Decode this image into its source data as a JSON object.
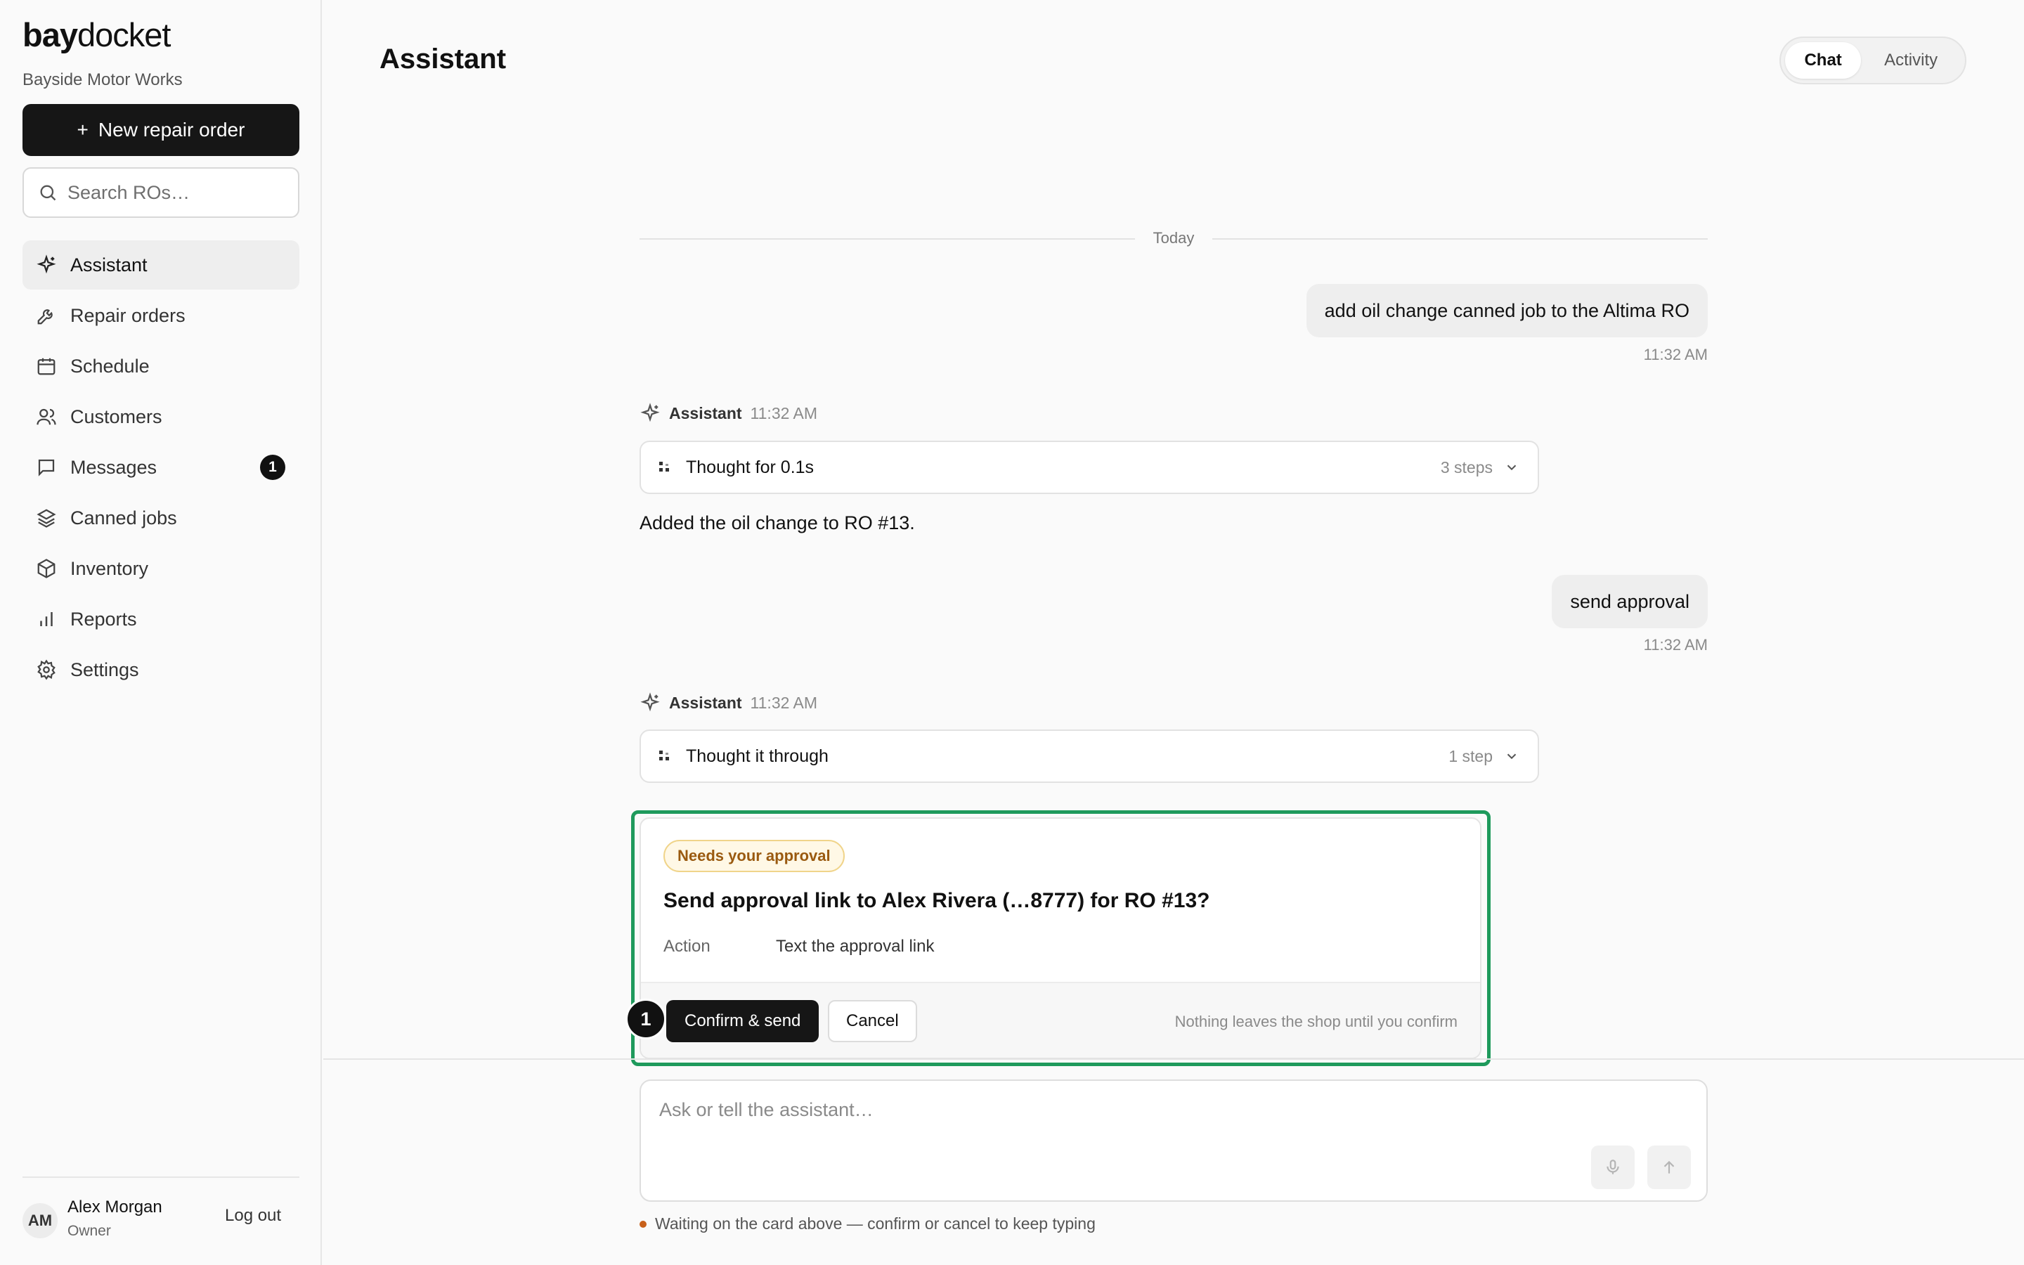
{
  "brand": {
    "logo_bold": "bay",
    "logo_light": "docket",
    "shop_name": "Bayside Motor Works"
  },
  "sidebar": {
    "new_ro_label": "New repair order",
    "search_placeholder": "Search ROs…",
    "items": [
      {
        "label": "Assistant",
        "icon": "sparkle-icon",
        "active": true
      },
      {
        "label": "Repair orders",
        "icon": "wrench-icon"
      },
      {
        "label": "Schedule",
        "icon": "calendar-icon"
      },
      {
        "label": "Customers",
        "icon": "users-icon"
      },
      {
        "label": "Messages",
        "icon": "message-icon",
        "badge": "1"
      },
      {
        "label": "Canned jobs",
        "icon": "layers-icon"
      },
      {
        "label": "Inventory",
        "icon": "box-icon"
      },
      {
        "label": "Reports",
        "icon": "bar-chart-icon"
      },
      {
        "label": "Settings",
        "icon": "gear-icon"
      }
    ],
    "user": {
      "initials": "AM",
      "name": "Alex Morgan",
      "role": "Owner",
      "logout_label": "Log out"
    }
  },
  "header": {
    "title": "Assistant",
    "tabs": [
      {
        "label": "Chat",
        "active": true
      },
      {
        "label": "Activity",
        "active": false
      }
    ]
  },
  "chat": {
    "day_label": "Today",
    "messages": [
      {
        "role": "user",
        "text": "add oil change canned job to the Altima RO",
        "time": "11:32 AM"
      },
      {
        "role": "assistant",
        "name": "Assistant",
        "time": "11:32 AM",
        "thought": "Thought for 0.1s",
        "steps": "3 steps",
        "reply": "Added the oil change to RO #13."
      },
      {
        "role": "user",
        "text": "send approval",
        "time": "11:32 AM"
      },
      {
        "role": "assistant",
        "name": "Assistant",
        "time": "11:32 AM",
        "thought": "Thought it through",
        "steps": "1 step"
      }
    ],
    "approval_card": {
      "pill": "Needs your approval",
      "title": "Send approval link to Alex Rivera (…8777) for RO #13?",
      "action_key": "Action",
      "action_value": "Text the approval link",
      "confirm_label": "Confirm & send",
      "cancel_label": "Cancel",
      "note": "Nothing leaves the shop until you confirm",
      "marker": "1"
    }
  },
  "composer": {
    "placeholder": "Ask or tell the assistant…",
    "status": "Waiting on the card above — confirm or cancel to keep typing"
  },
  "colors": {
    "accent_outline": "#1f9a5c",
    "pill_text": "#9a5a10",
    "status_dot": "#c8601a",
    "primary": "#161616"
  }
}
